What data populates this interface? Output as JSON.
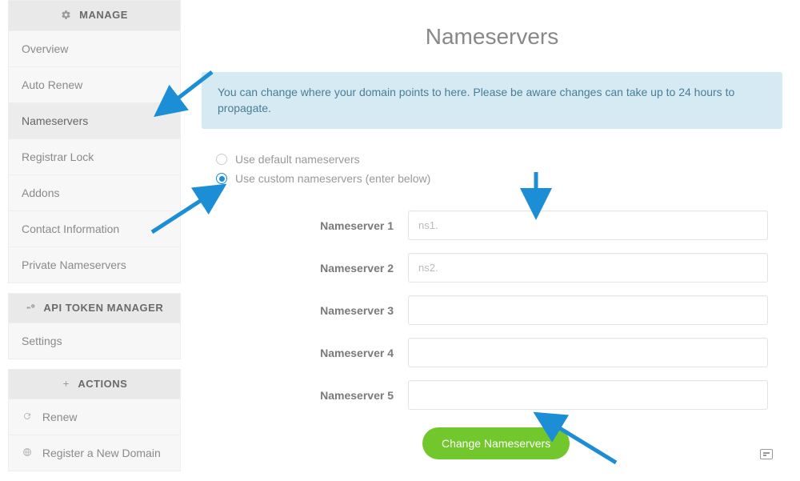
{
  "sidebar": {
    "manage": {
      "header": "MANAGE",
      "items": [
        {
          "label": "Overview"
        },
        {
          "label": "Auto Renew"
        },
        {
          "label": "Nameservers"
        },
        {
          "label": "Registrar Lock"
        },
        {
          "label": "Addons"
        },
        {
          "label": "Contact Information"
        },
        {
          "label": "Private Nameservers"
        }
      ]
    },
    "api": {
      "header": "API TOKEN MANAGER",
      "items": [
        {
          "label": "Settings"
        }
      ]
    },
    "actions": {
      "header": "ACTIONS",
      "items": [
        {
          "label": "Renew"
        },
        {
          "label": "Register a New Domain"
        }
      ]
    }
  },
  "page": {
    "title": "Nameservers",
    "info": "You can change where your domain points to here. Please be aware changes can take up to 24 hours to propagate."
  },
  "radios": {
    "default": "Use default nameservers",
    "custom": "Use custom nameservers (enter below)"
  },
  "form": {
    "rows": [
      {
        "label": "Nameserver 1",
        "value": "ns1."
      },
      {
        "label": "Nameserver 2",
        "value": "ns2."
      },
      {
        "label": "Nameserver 3",
        "value": ""
      },
      {
        "label": "Nameserver 4",
        "value": ""
      },
      {
        "label": "Nameserver 5",
        "value": ""
      }
    ],
    "submit": "Change Nameservers"
  }
}
